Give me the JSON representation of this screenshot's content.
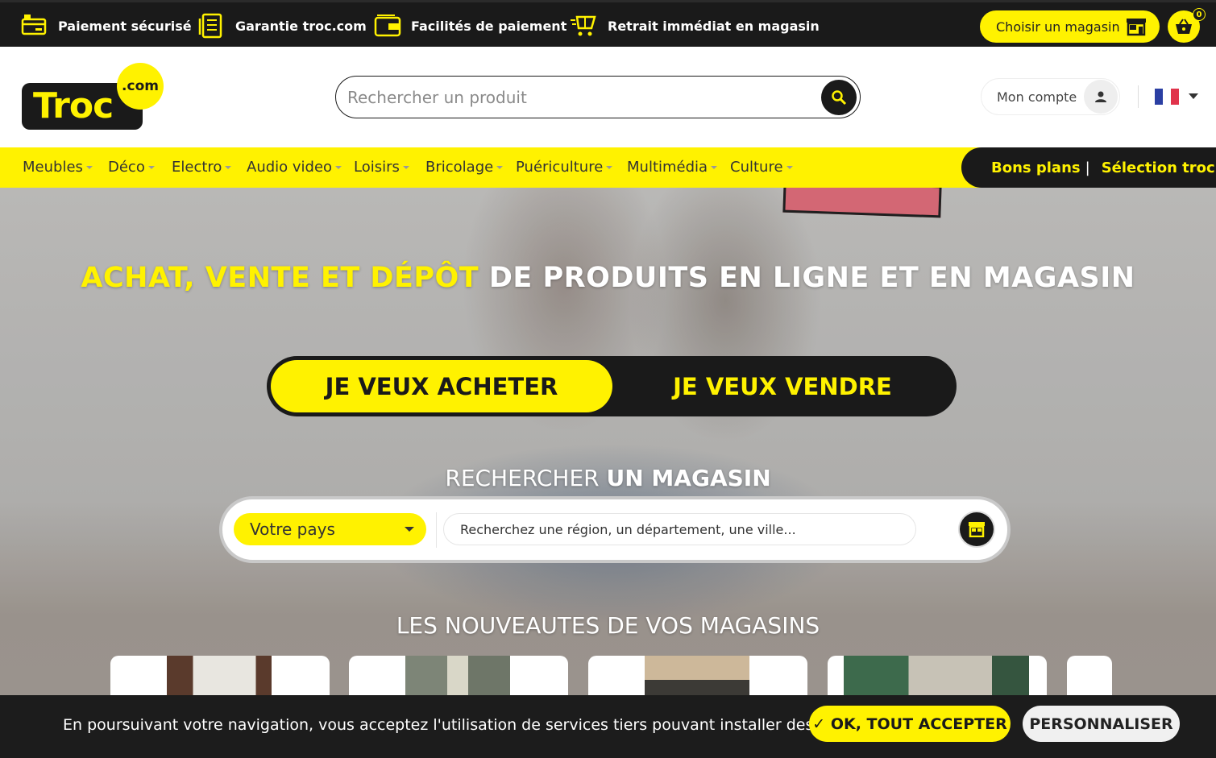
{
  "topbar": {
    "usps": [
      {
        "icon": "card-icon",
        "label": "Paiement sécurisé"
      },
      {
        "icon": "document-icon",
        "label": "Garantie troc.com"
      },
      {
        "icon": "wallet-icon",
        "label": "Facilités de paiement"
      },
      {
        "icon": "cart-fast-icon",
        "label": "Retrait immédiat en magasin"
      }
    ],
    "store_button": "Choisir un magasin",
    "cart_count": "0"
  },
  "header": {
    "logo_main": "Troc",
    "logo_suffix": ".com",
    "search_placeholder": "Rechercher un produit",
    "account_label": "Mon compte",
    "language": "FR"
  },
  "nav": {
    "items": [
      "Meubles",
      "Déco",
      "Electro",
      "Audio video",
      "Loisirs",
      "Bricolage",
      "Puériculture",
      "Multimédia",
      "Culture"
    ],
    "bons_plans": "Bons plans",
    "separator": "|",
    "selection": "Sélection troc"
  },
  "hero": {
    "title_highlight": "ACHAT, VENTE ET DÉPÔT",
    "title_rest": " DE PRODUITS EN LIGNE ET EN MAGASIN",
    "buy_label": "JE VEUX ACHETER",
    "sell_label": "JE VEUX VENDRE",
    "store_title_light": "RECHERCHER ",
    "store_title_bold": "UN MAGASIN",
    "country_label": "Votre pays",
    "region_placeholder": "Recherchez une région, un département, une ville...",
    "news_title": "LES NOUVEAUTES DE VOS MAGASINS"
  },
  "cookie": {
    "message": "En poursuivant votre navigation, vous acceptez l'utilisation de services tiers pouvant installer des cookies",
    "accept_label": "✓ OK, TOUT ACCEPTER",
    "customize_label": "PERSONNALISER"
  },
  "colors": {
    "brand_yellow": "#fff200",
    "brand_dark": "#1a1a1a"
  }
}
